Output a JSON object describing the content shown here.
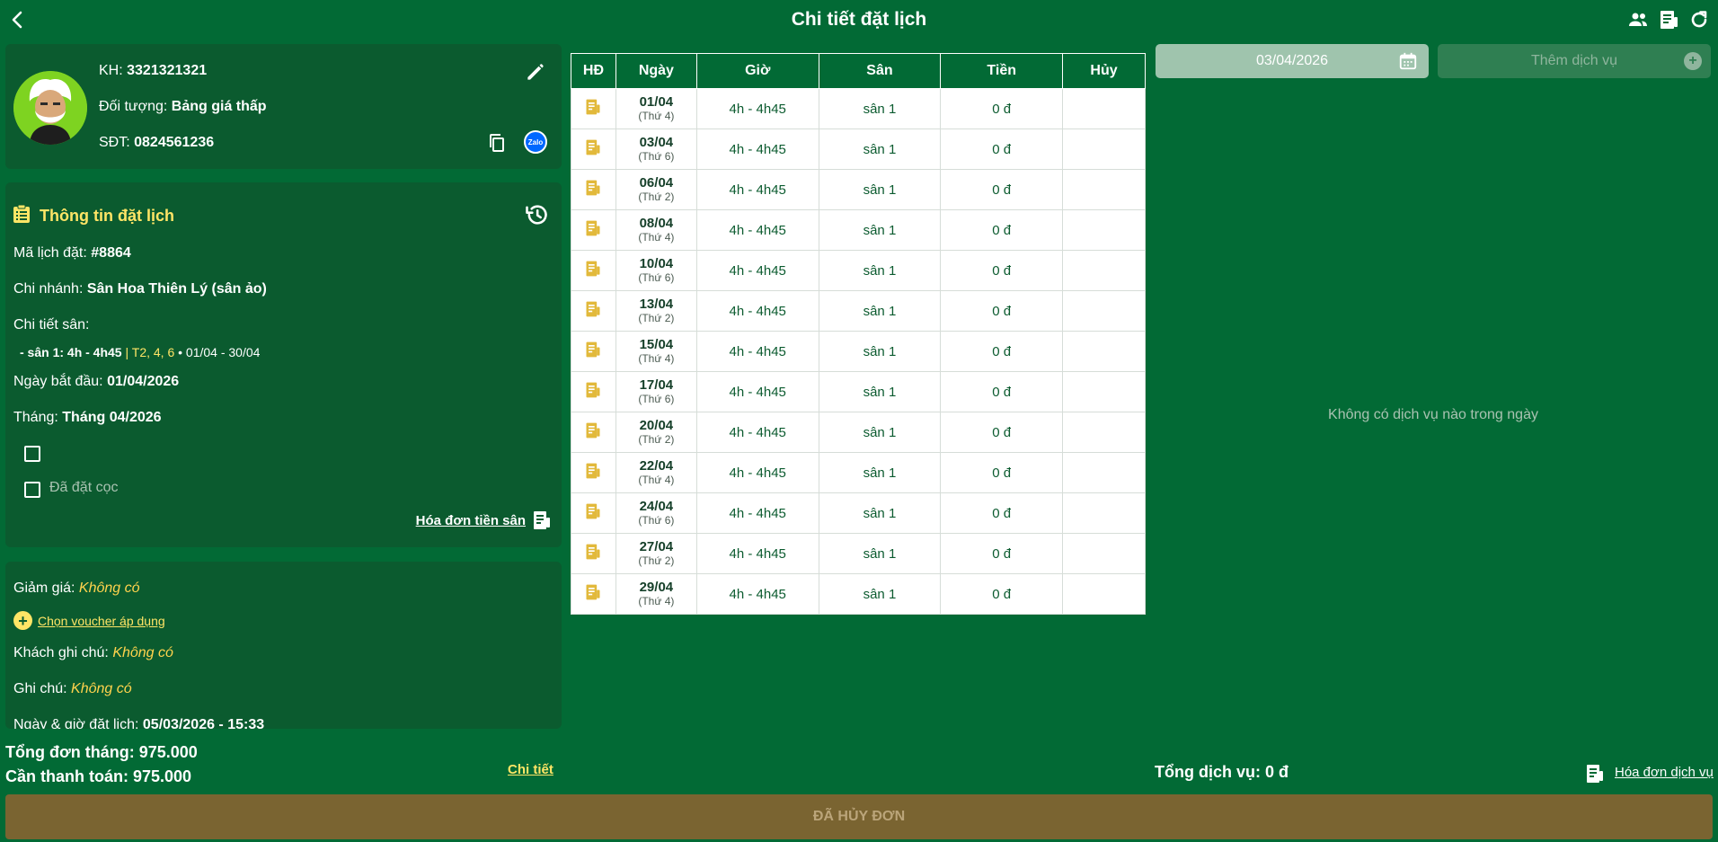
{
  "header": {
    "title": "Chi tiết đặt lịch"
  },
  "customer": {
    "kh_label": "KH:",
    "kh_value": "3321321321",
    "target_label": "Đối tượng:",
    "target_value": "Bảng giá thấp",
    "phone_label": "SĐT:",
    "phone_value": "0824561236",
    "zalo_text": "Zalo"
  },
  "booking": {
    "section_title": "Thông tin đặt lịch",
    "code_label": "Mã lịch đặt:",
    "code_value": "#8864",
    "branch_label": "Chi nhánh:",
    "branch_value": "Sân Hoa Thiên Lý (sân ảo)",
    "court_detail_label": "Chi tiết sân:",
    "court_line_main": "- sân 1: 4h - 4h45",
    "court_line_sep": "|",
    "court_line_days": "T2, 4, 6",
    "court_line_range": "• 01/04 - 30/04",
    "start_label": "Ngày bắt đầu:",
    "start_value": "01/04/2026",
    "month_label": "Tháng:",
    "month_value": "Tháng 04/2026",
    "deposit_label": "Đã đặt cọc",
    "invoice_link": "Hóa đơn tiền sân"
  },
  "extra": {
    "discount_label": "Giảm giá:",
    "discount_value": "Không có",
    "voucher_link": "Chọn voucher áp dụng",
    "customer_note_label": "Khách ghi chú:",
    "customer_note_value": "Không có",
    "note_label": "Ghi chú:",
    "note_value": "Không có",
    "booked_at_label": "Ngày & giờ đặt lịch:",
    "booked_at_value": "05/03/2026 - 15:33"
  },
  "totals": {
    "month_total": "Tổng đơn tháng: 975.000",
    "to_pay": "Cần thanh toán: 975.000",
    "detail_link": "Chi tiết"
  },
  "table": {
    "headers": [
      "HĐ",
      "Ngày",
      "Giờ",
      "Sân",
      "Tiền",
      "Hủy"
    ],
    "rows": [
      {
        "date": "01/04",
        "weekday": "(Thứ 4)",
        "time": "4h - 4h45",
        "court": "sân 1",
        "price": "0 đ"
      },
      {
        "date": "03/04",
        "weekday": "(Thứ 6)",
        "time": "4h - 4h45",
        "court": "sân 1",
        "price": "0 đ"
      },
      {
        "date": "06/04",
        "weekday": "(Thứ 2)",
        "time": "4h - 4h45",
        "court": "sân 1",
        "price": "0 đ"
      },
      {
        "date": "08/04",
        "weekday": "(Thứ 4)",
        "time": "4h - 4h45",
        "court": "sân 1",
        "price": "0 đ"
      },
      {
        "date": "10/04",
        "weekday": "(Thứ 6)",
        "time": "4h - 4h45",
        "court": "sân 1",
        "price": "0 đ"
      },
      {
        "date": "13/04",
        "weekday": "(Thứ 2)",
        "time": "4h - 4h45",
        "court": "sân 1",
        "price": "0 đ"
      },
      {
        "date": "15/04",
        "weekday": "(Thứ 4)",
        "time": "4h - 4h45",
        "court": "sân 1",
        "price": "0 đ"
      },
      {
        "date": "17/04",
        "weekday": "(Thứ 6)",
        "time": "4h - 4h45",
        "court": "sân 1",
        "price": "0 đ"
      },
      {
        "date": "20/04",
        "weekday": "(Thứ 2)",
        "time": "4h - 4h45",
        "court": "sân 1",
        "price": "0 đ"
      },
      {
        "date": "22/04",
        "weekday": "(Thứ 4)",
        "time": "4h - 4h45",
        "court": "sân 1",
        "price": "0 đ"
      },
      {
        "date": "24/04",
        "weekday": "(Thứ 6)",
        "time": "4h - 4h45",
        "court": "sân 1",
        "price": "0 đ"
      },
      {
        "date": "27/04",
        "weekday": "(Thứ 2)",
        "time": "4h - 4h45",
        "court": "sân 1",
        "price": "0 đ"
      },
      {
        "date": "29/04",
        "weekday": "(Thứ 4)",
        "time": "4h - 4h45",
        "court": "sân 1",
        "price": "0 đ"
      }
    ]
  },
  "services": {
    "date_value": "03/04/2026",
    "add_placeholder": "Thêm dịch vụ",
    "empty_text": "Không có dịch vụ nào trong ngày",
    "total": "Tổng dịch vụ: 0 đ",
    "invoice_link": "Hóa đơn dịch vụ"
  },
  "footer": {
    "cancel_label": "ĐÃ HỦY ĐƠN"
  },
  "colors": {
    "background": "#026a35",
    "card": "#0b5b2f",
    "accent": "#ffe566",
    "cancel_bar": "#7a6431"
  }
}
